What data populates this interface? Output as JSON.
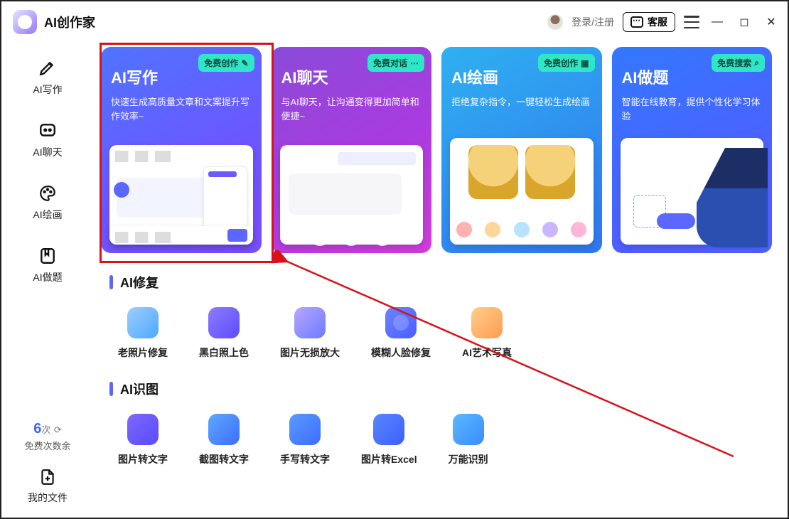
{
  "app": {
    "name": "AI创作家"
  },
  "titlebar": {
    "login": "登录/注册",
    "kefu": "客服"
  },
  "sidebar": {
    "items": [
      {
        "label": "AI写作"
      },
      {
        "label": "AI聊天"
      },
      {
        "label": "AI绘画"
      },
      {
        "label": "AI做题"
      }
    ],
    "free": {
      "num": "6",
      "ci": "次",
      "sub": "免费次数余"
    },
    "myfiles": "我的文件"
  },
  "cards": [
    {
      "tag": "免费创作",
      "title": "AI写作",
      "desc": "快速生成高质量文章和文案提升写作效率~"
    },
    {
      "tag": "免费对话",
      "title": "AI聊天",
      "desc": "与AI聊天，让沟通变得更加简单和便捷~"
    },
    {
      "tag": "免费创作",
      "title": "AI绘画",
      "desc": "拒绝复杂指令，一键轻松生成绘画"
    },
    {
      "tag": "免费搜索",
      "title": "AI做题",
      "desc": "智能在线教育，提供个性化学习体验"
    }
  ],
  "section_repair": {
    "title": "AI修复",
    "tiles": [
      "老照片修复",
      "黑白照上色",
      "图片无损放大",
      "模糊人脸修复",
      "AI艺术写真"
    ]
  },
  "section_ocr": {
    "title": "AI识图",
    "tiles": [
      "图片转文字",
      "截图转文字",
      "手写转文字",
      "图片转Excel",
      "万能识别"
    ]
  }
}
